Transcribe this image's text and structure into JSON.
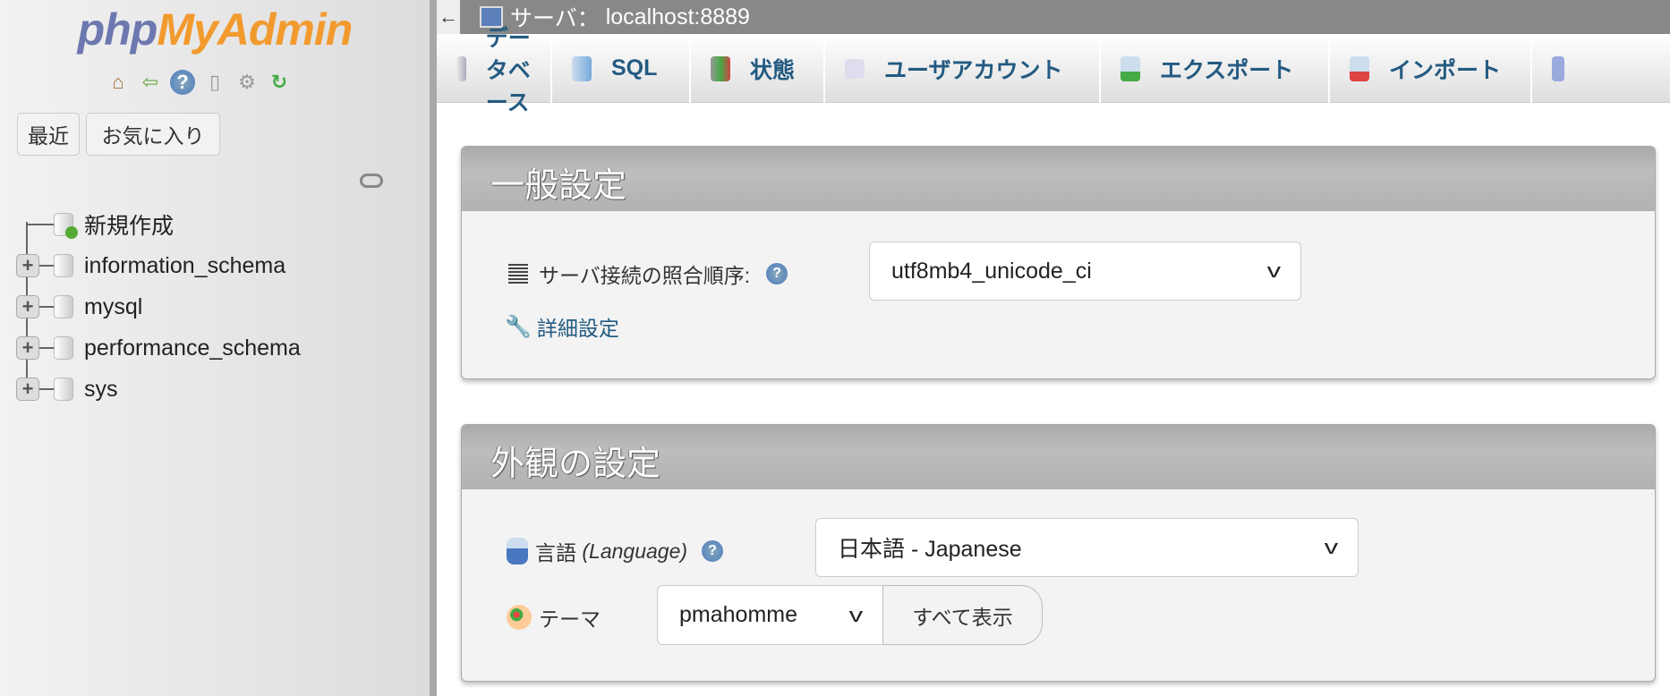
{
  "sidebar": {
    "logo": {
      "php": "php",
      "myadmin": "MyAdmin"
    },
    "nav_icons": [
      "home-icon",
      "logout-icon",
      "help-icon",
      "docs-icon",
      "settings-icon",
      "reload-icon"
    ],
    "recent_label": "最近",
    "favorites_label": "お気に入り",
    "tree": {
      "new_label": "新規作成",
      "databases": [
        "information_schema",
        "mysql",
        "performance_schema",
        "sys"
      ]
    }
  },
  "topbar": {
    "back": "←",
    "server_label": "サーバ：",
    "server_value": "localhost:8889"
  },
  "tabs": [
    {
      "label": "データベース"
    },
    {
      "label": "SQL"
    },
    {
      "label": "状態"
    },
    {
      "label": "ユーザアカウント"
    },
    {
      "label": "エクスポート"
    },
    {
      "label": "インポート"
    }
  ],
  "general": {
    "title": "一般設定",
    "collation_label": "サーバ接続の照合順序:",
    "collation_value": "utf8mb4_unicode_ci",
    "advanced_link": "詳細設定"
  },
  "appearance": {
    "title": "外観の設定",
    "language_label": "言語",
    "language_label_en": "(Language)",
    "language_value": "日本語 - Japanese",
    "theme_label": "テーマ",
    "theme_value": "pmahomme",
    "theme_view_all": "すべて表示"
  },
  "help_glyph": "?",
  "chevron": "v",
  "plus": "+"
}
